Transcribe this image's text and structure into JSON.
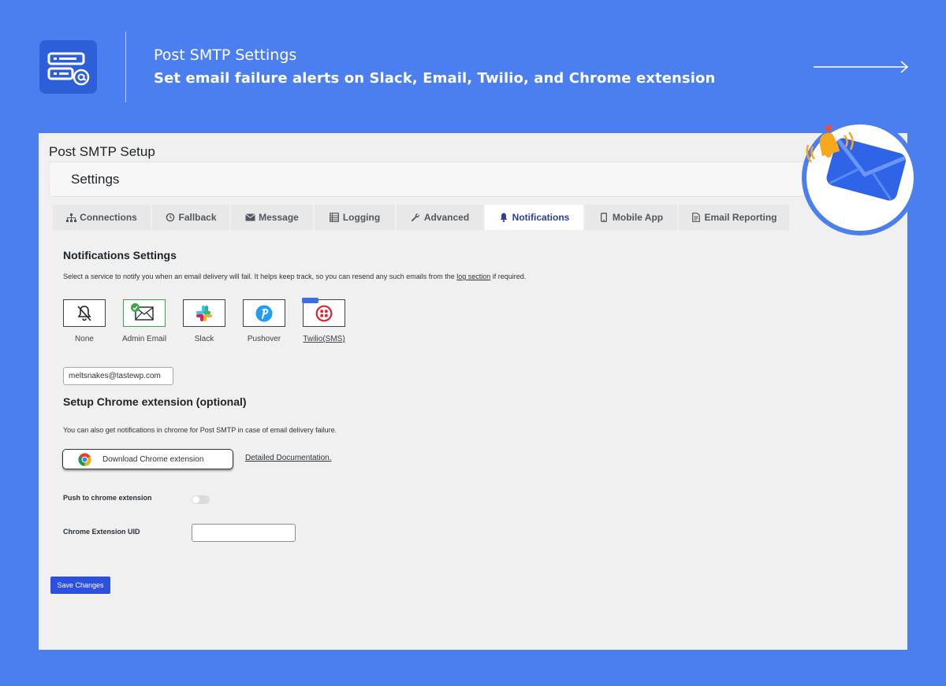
{
  "banner": {
    "title": "Post SMTP Settings",
    "subtitle": "Set email failure alerts on Slack, Email, Twilio, and Chrome extension"
  },
  "panel": {
    "setup_title": "Post SMTP Setup",
    "settings_heading": "Settings"
  },
  "tabs": [
    {
      "label": "Connections",
      "icon": "sitemap-icon",
      "active": false
    },
    {
      "label": "Fallback",
      "icon": "history-icon",
      "active": false
    },
    {
      "label": "Message",
      "icon": "envelope-icon",
      "active": false
    },
    {
      "label": "Logging",
      "icon": "list-icon",
      "active": false
    },
    {
      "label": "Advanced",
      "icon": "wrench-icon",
      "active": false
    },
    {
      "label": "Notifications",
      "icon": "bell-icon",
      "active": true
    },
    {
      "label": "Mobile App",
      "icon": "mobile-icon",
      "active": false
    },
    {
      "label": "Email Reporting",
      "icon": "report-icon",
      "active": false
    }
  ],
  "notifications": {
    "heading": "Notifications Settings",
    "description_before": "Select a service to notify you when an email delivery will fail. It helps keep track, so you can resend any such emails from the ",
    "description_link": "log section",
    "description_after": " if required.",
    "services": [
      {
        "label": "None",
        "icon": "bell-off-icon",
        "selected": false
      },
      {
        "label": "Admin Email",
        "icon": "envelope-icon",
        "selected": true
      },
      {
        "label": "Slack",
        "icon": "slack-icon",
        "selected": false
      },
      {
        "label": "Pushover",
        "icon": "pushover-icon",
        "selected": false
      },
      {
        "label": "Twilio(SMS)",
        "icon": "twilio-icon",
        "selected": false,
        "pro": true
      }
    ],
    "email_value": "meltsnakes@tastewp.com"
  },
  "chrome": {
    "heading": "Setup Chrome extension (optional)",
    "description": "You can also get notifications in chrome for Post SMTP in case of email delivery failure.",
    "download_label": "Download Chrome extension",
    "doc_link": "Detailed Documentation.",
    "push_label": "Push to chrome extension",
    "push_enabled": false,
    "uid_label": "Chrome Extension UID",
    "uid_value": ""
  },
  "save_label": "Save Changes",
  "colors": {
    "background": "#4b7ff0",
    "accent": "#2c50df",
    "active_tab_text": "#2c3e9a",
    "selected_border": "#3aa54a"
  }
}
